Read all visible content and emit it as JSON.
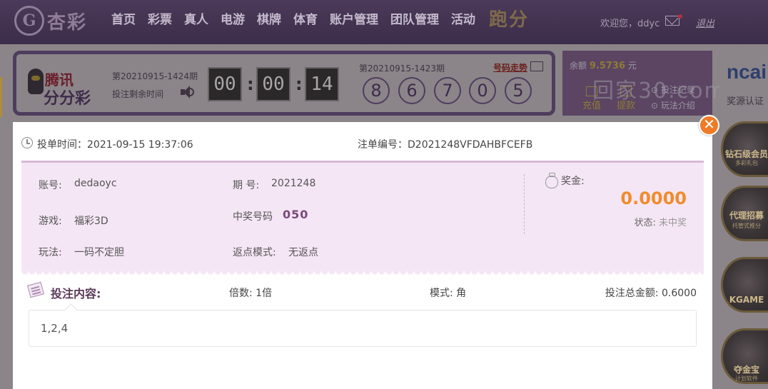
{
  "brand": {
    "logo_text": "杏彩"
  },
  "nav": {
    "items": [
      "首页",
      "彩票",
      "真人",
      "电游",
      "棋牌",
      "体育",
      "账户管理",
      "团队管理",
      "活动"
    ],
    "paofen": "跑分"
  },
  "user": {
    "welcome": "欢迎您，ddyc",
    "logout": "退出"
  },
  "game": {
    "logo_top": "腾讯",
    "logo_bottom": "分分彩",
    "next_issue": "第20210915-1424期",
    "remain_label": "投注剩余时间",
    "countdown": [
      "00",
      "00",
      "14"
    ],
    "last_issue": "第20210915-1423期",
    "trend_link": "号码走势",
    "balls": [
      "8",
      "6",
      "7",
      "0",
      "5"
    ]
  },
  "account": {
    "balance_label": "余额",
    "balance_value": "9.5736",
    "balance_unit": "元",
    "deposit": "充值",
    "withdraw": "提款",
    "bet_record": "投注记录",
    "rules": "玩法介绍",
    "watermark": "回家30.com",
    "ncai": "ncai",
    "verify": "奖源认证"
  },
  "badges": [
    {
      "label": "钻石级会员",
      "sub": "多彩礼包"
    },
    {
      "label": "代理招募",
      "sub": "托管式推分"
    },
    {
      "label": "KGAME",
      "sub": ""
    },
    {
      "label": "夺金宝",
      "sub": "计划软件"
    }
  ],
  "modal": {
    "bet_time_label": "投单时间：",
    "bet_time": "2021-09-15 19:37:06",
    "order_no_label": "注单编号：",
    "order_no": "D2021248VFDAHBFCEFB",
    "account_label": "账号:",
    "account": "dedaoyc",
    "issue_label": "期 号:",
    "issue": "2021248",
    "game_label": "游戏:",
    "game": "福彩3D",
    "win_no_label": "中奖号码",
    "win_no": "050",
    "play_label": "玩法:",
    "play": "一码不定胆",
    "rebate_label": "返点模式:",
    "rebate": "无返点",
    "prize_label": "奖金:",
    "prize": "0.0000",
    "status_label": "状态:",
    "status": "未中奖",
    "content_title": "投注内容:",
    "multiple_label": "倍数:",
    "multiple": "1倍",
    "mode_label": "模式:",
    "mode": "角",
    "total_label": "投注总金额:",
    "total": "0.6000",
    "content": "1,2,4"
  },
  "colors": {
    "accent": "#f08c2c",
    "brand": "#4b3a59",
    "info_bg": "#f5e6f5"
  }
}
